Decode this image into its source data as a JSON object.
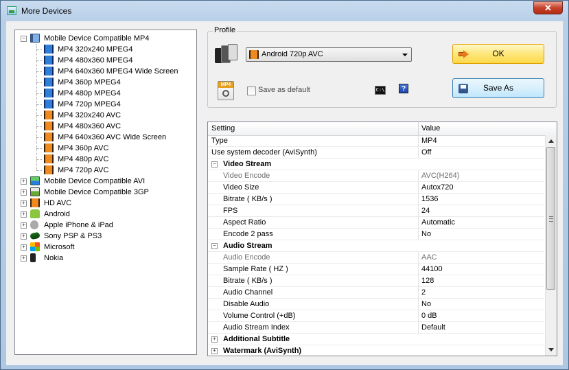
{
  "window": {
    "title": "More Devices",
    "close_label": "✕"
  },
  "tree": {
    "groups": [
      {
        "label": "Mobile Device Compatible MP4",
        "expanded": true,
        "icon": "mp4-group-icon",
        "children": [
          {
            "label": "MP4 320x240 MPEG4",
            "icon": "film-blue-icon"
          },
          {
            "label": "MP4 480x360 MPEG4",
            "icon": "film-blue-icon"
          },
          {
            "label": "MP4 640x360 MPEG4 Wide Screen",
            "icon": "film-blue-icon"
          },
          {
            "label": "MP4 360p MPEG4",
            "icon": "film-blue-icon"
          },
          {
            "label": "MP4 480p MPEG4",
            "icon": "film-blue-icon"
          },
          {
            "label": "MP4 720p MPEG4",
            "icon": "film-blue-icon"
          },
          {
            "label": "MP4 320x240 AVC",
            "icon": "film-orange-icon"
          },
          {
            "label": "MP4 480x360 AVC",
            "icon": "film-orange-icon"
          },
          {
            "label": "MP4 640x360 AVC Wide Screen",
            "icon": "film-orange-icon"
          },
          {
            "label": "MP4 360p AVC",
            "icon": "film-orange-icon"
          },
          {
            "label": "MP4 480p AVC",
            "icon": "film-orange-icon"
          },
          {
            "label": "MP4 720p AVC",
            "icon": "film-orange-icon"
          }
        ]
      },
      {
        "label": "Mobile Device Compatible AVI",
        "icon": "avi-group-icon"
      },
      {
        "label": "Mobile Device Compatible 3GP",
        "icon": "3gp-group-icon"
      },
      {
        "label": "HD AVC",
        "icon": "hd-avc-icon"
      },
      {
        "label": "Android",
        "icon": "android-icon"
      },
      {
        "label": "Apple iPhone & iPad",
        "icon": "apple-icon"
      },
      {
        "label": "Sony PSP & PS3",
        "icon": "psp-icon"
      },
      {
        "label": "Microsoft",
        "icon": "microsoft-icon"
      },
      {
        "label": "Nokia",
        "icon": "nokia-icon"
      }
    ]
  },
  "profile": {
    "legend": "Profile",
    "selected": "Android 720p AVC",
    "save_default_label": "Save as default",
    "save_default_checked": false,
    "cmd_label": "C:\\",
    "help_label": "?",
    "ok_label": "OK",
    "save_as_label": "Save As"
  },
  "grid": {
    "col_setting": "Setting",
    "col_value": "Value",
    "rows": [
      {
        "kind": "row",
        "setting": "Type",
        "value": "MP4"
      },
      {
        "kind": "row",
        "setting": "Use system decoder (AviSynth)",
        "value": "Off"
      },
      {
        "kind": "cat",
        "setting": "Video Stream",
        "expander": "−"
      },
      {
        "kind": "sub",
        "setting": "Video Encode",
        "value": "AVC(H264)",
        "disabled": true
      },
      {
        "kind": "sub",
        "setting": "Video Size",
        "value": "Autox720"
      },
      {
        "kind": "sub",
        "setting": "Bitrate ( KB/s )",
        "value": "1536"
      },
      {
        "kind": "sub",
        "setting": "FPS",
        "value": "24"
      },
      {
        "kind": "sub",
        "setting": "Aspect Ratio",
        "value": "Automatic"
      },
      {
        "kind": "sub",
        "setting": "Encode 2 pass",
        "value": "No"
      },
      {
        "kind": "cat",
        "setting": "Audio Stream",
        "expander": "−"
      },
      {
        "kind": "sub",
        "setting": "Audio Encode",
        "value": "AAC",
        "disabled": true
      },
      {
        "kind": "sub",
        "setting": "Sample Rate ( HZ )",
        "value": "44100"
      },
      {
        "kind": "sub",
        "setting": "Bitrate ( KB/s )",
        "value": "128"
      },
      {
        "kind": "sub",
        "setting": "Audio Channel",
        "value": "2"
      },
      {
        "kind": "sub",
        "setting": "Disable Audio",
        "value": "No"
      },
      {
        "kind": "sub",
        "setting": "Volume Control (+dB)",
        "value": "0 dB"
      },
      {
        "kind": "sub",
        "setting": "Audio Stream Index",
        "value": "Default"
      },
      {
        "kind": "cat",
        "setting": "Additional Subtitle",
        "expander": "+"
      },
      {
        "kind": "cat",
        "setting": "Watermark (AviSynth)",
        "expander": "+"
      }
    ]
  }
}
